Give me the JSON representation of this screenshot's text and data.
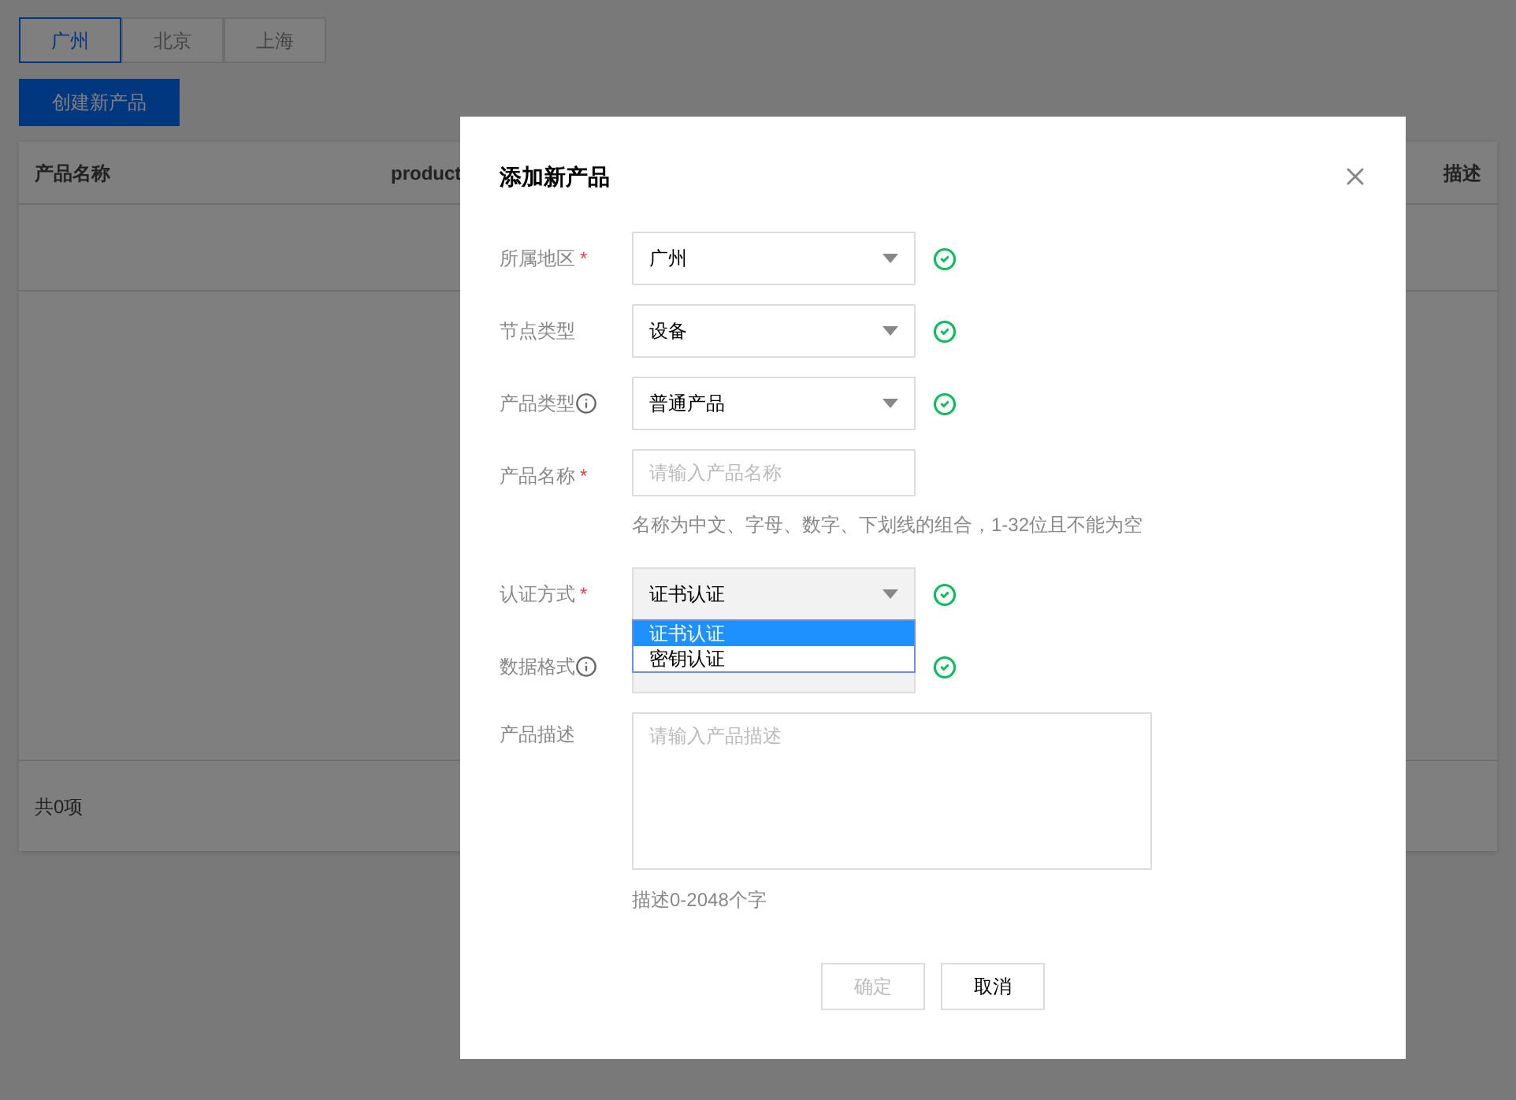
{
  "region_tabs": [
    {
      "label": "广州",
      "selected": true
    },
    {
      "label": "北京",
      "selected": false
    },
    {
      "label": "上海",
      "selected": false
    }
  ],
  "create_button": "创建新产品",
  "table": {
    "columns": [
      "产品名称",
      "product",
      "描述"
    ],
    "footer": "共0项"
  },
  "dialog": {
    "title": "添加新产品",
    "fields": [
      {
        "kind": "select",
        "label": "所属地区",
        "required_mark": "*",
        "value": "广州",
        "valid": true
      },
      {
        "kind": "select",
        "label": "节点类型",
        "value": "设备",
        "valid": true
      },
      {
        "kind": "select",
        "label": "产品类型",
        "info": true,
        "value": "普通产品",
        "valid": true
      },
      {
        "kind": "input",
        "label": "产品名称",
        "required_mark": "*",
        "placeholder": "请输入产品名称",
        "hint": "名称为中文、字母、数字、下划线的组合，1-32位且不能为空"
      },
      {
        "kind": "select",
        "label": "认证方式",
        "required_mark": "*",
        "value": "证书认证",
        "valid": true,
        "open": true,
        "options": [
          {
            "label": "证书认证",
            "selected": true
          },
          {
            "label": "密钥认证",
            "selected": false
          }
        ]
      },
      {
        "kind": "select",
        "label": "数据格式",
        "info": true,
        "valid": true,
        "disabled": true
      },
      {
        "kind": "textarea",
        "label": "产品描述",
        "placeholder": "请输入产品描述",
        "hint": "描述0-2048个字"
      }
    ],
    "buttons": [
      {
        "label": "确定",
        "disabled": true
      },
      {
        "label": "取消",
        "disabled": false
      }
    ]
  }
}
